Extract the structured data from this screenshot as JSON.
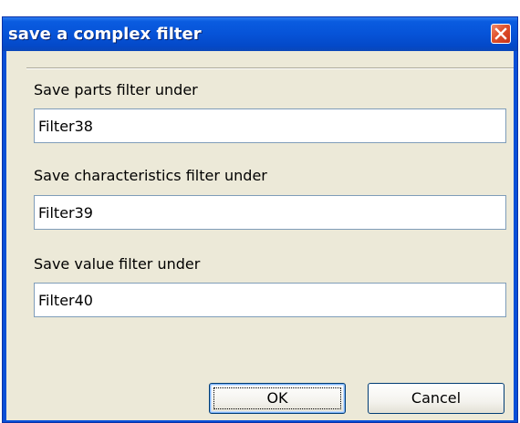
{
  "window": {
    "title": "save a complex filter"
  },
  "fields": [
    {
      "label": "Save parts filter under",
      "value": "Filter38"
    },
    {
      "label": "Save characteristics filter under",
      "value": "Filter39"
    },
    {
      "label": "Save value filter under",
      "value": "Filter40"
    }
  ],
  "buttons": {
    "ok": "OK",
    "cancel": "Cancel"
  },
  "icons": {
    "close": "close-icon"
  },
  "colors": {
    "titlebar": "#0653d8",
    "client": "#ece9d8",
    "close_button": "#e0502a",
    "field_border": "#7f9db9"
  }
}
